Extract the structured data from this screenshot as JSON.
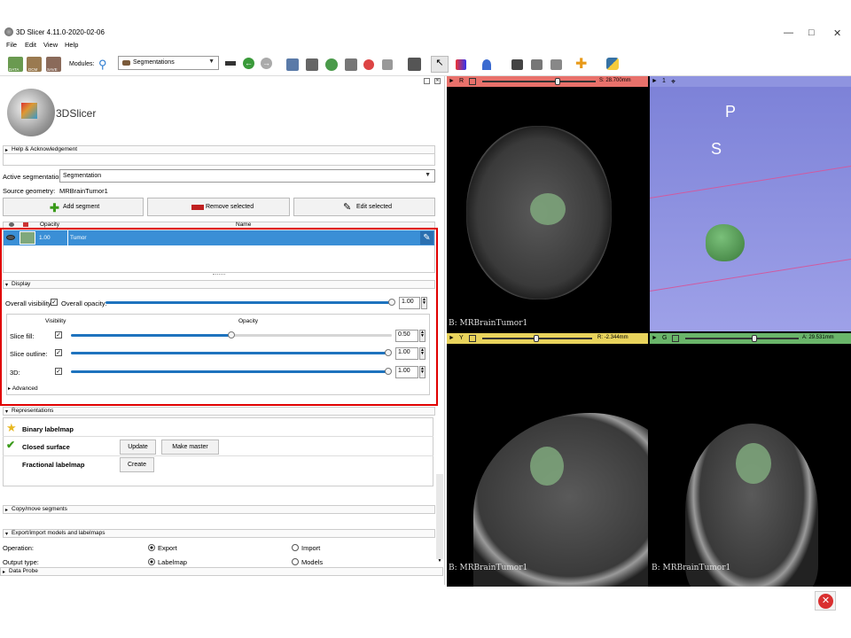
{
  "window": {
    "title": "3D Slicer 4.11.0-2020-02-06"
  },
  "menu": [
    "File",
    "Edit",
    "View",
    "Help"
  ],
  "toolbar": {
    "data": "DATA",
    "dcm": "DCM",
    "save": "SAVE",
    "modules_label": "Modules:",
    "module": "Segmentations"
  },
  "logo": {
    "text": "3DSlicer"
  },
  "sections": {
    "help": "Help & Acknowledgement",
    "display": "Display",
    "representations": "Representations",
    "copy_move": "Copy/move segments",
    "export_import": "Export/import models and labelmaps",
    "data_probe": "Data Probe"
  },
  "segmentation": {
    "active_label": "Active segmentation:",
    "active_value": "Segmentation",
    "source_label": "Source geometry:",
    "source_value": "MRBrainTumor1",
    "add": "Add segment",
    "remove": "Remove selected",
    "edit": "Edit selected"
  },
  "table": {
    "headers": [
      "Opacity",
      "Name"
    ],
    "rows": [
      {
        "opacity": "1.00",
        "name": "Tumor",
        "color": "#7fa87c"
      }
    ]
  },
  "display": {
    "overall_visibility": "Overall visibility:",
    "overall_opacity_label": "Overall opacity:",
    "overall_opacity": "1.00",
    "col_visibility": "Visibility",
    "col_opacity": "Opacity",
    "rows": [
      {
        "label": "Slice fill:",
        "value": "0.50",
        "level": 0.5
      },
      {
        "label": "Slice outline:",
        "value": "1.00",
        "level": 1.0
      },
      {
        "label": "3D:",
        "value": "1.00",
        "level": 1.0
      }
    ],
    "advanced": "Advanced"
  },
  "representations": {
    "rows": [
      {
        "name": "Binary labelmap",
        "icon": "star-icon"
      },
      {
        "name": "Closed surface",
        "icon": "checkmark-icon",
        "buttons": [
          "Update",
          "Make master"
        ]
      },
      {
        "name": "Fractional labelmap",
        "buttons": [
          "Create"
        ]
      }
    ]
  },
  "export": {
    "operation_label": "Operation:",
    "export": "Export",
    "import": "Import",
    "output_label": "Output type:",
    "labelmap": "Labelmap",
    "models": "Models"
  },
  "views": {
    "red": {
      "letter": "R",
      "offset": "S: 28.700mm",
      "label": "B: MRBrainTumor1",
      "color": "#e8716b",
      "level": 0.55
    },
    "threed": {
      "letter": "1",
      "label_p": "P",
      "label_s": "S",
      "color": "#8f94e0"
    },
    "yellow": {
      "letter": "Y",
      "offset": "R: -2.344mm",
      "label": "B: MRBrainTumor1",
      "color": "#e8d35c",
      "level": 0.4
    },
    "green": {
      "letter": "G",
      "offset": "A: 29.531mm",
      "label": "B: MRBrainTumor1",
      "color": "#6ab56a",
      "level": 0.55
    }
  },
  "colors": {
    "selection": "#3a8fd6",
    "highlight": "#e00000",
    "accent": "#1e73be"
  }
}
